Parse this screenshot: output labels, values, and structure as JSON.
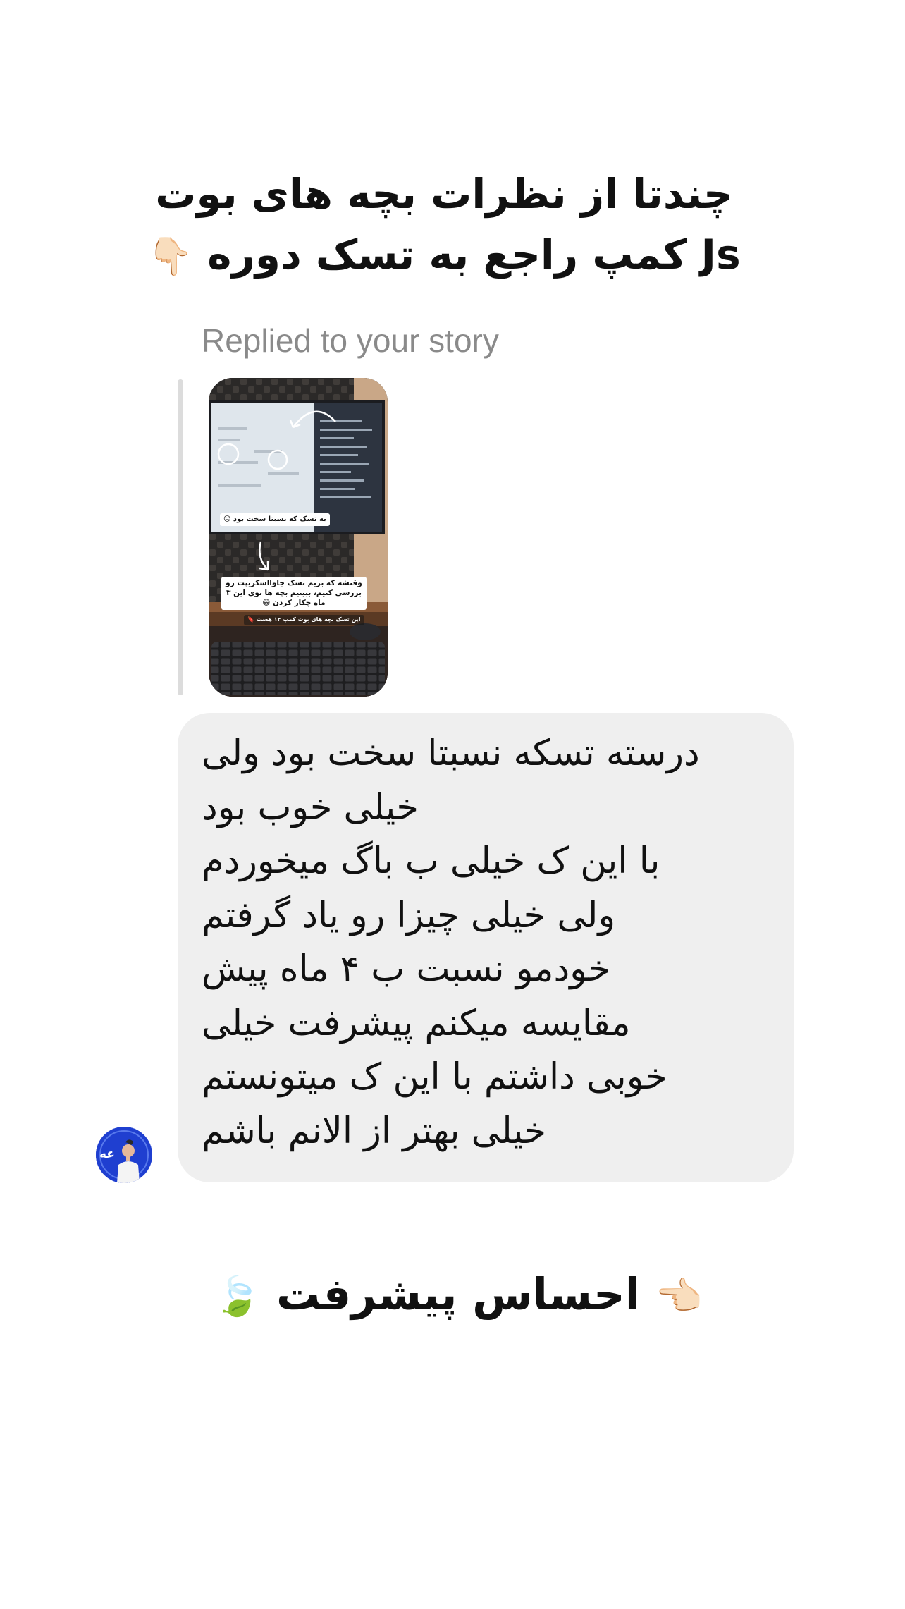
{
  "heading": {
    "line1": "چندتا از نظرات بچه های بوت",
    "line2": "کمپ راجع به تسک دوره Js",
    "line2_emoji": "👇🏻"
  },
  "reply": {
    "caption": "Replied to your story",
    "story_captions": [
      "به تسک که نسبتا سخت بود 😑",
      "وقتشه که بریم تسک جاوااسکریپت رو بررسی کنیم، ببینیم بچه ها توی این ۳ ماه چکار کردن 😁",
      "این تسک بچه های بوت کمپ ۱۲ هست 🔖"
    ]
  },
  "message": {
    "lines": [
      "درسته تسکه نسبتا سخت بود ولی",
      "خیلی خوب بود",
      "با این ک خیلی ب باگ میخوردم",
      "ولی خیلی چیزا رو یاد گرفتم",
      "خودمو نسبت ب ۴ ماه پیش",
      "مقایسه میکنم پیشرفت خیلی",
      "خوبی داشتم با این ک میتونستم",
      "خیلی بهتر از الانم باشم"
    ],
    "avatar_text": "عه"
  },
  "footer": {
    "pointer_emoji": "👈🏻",
    "text": "احساس پیشرفت",
    "leaf_emoji": "🍃"
  }
}
